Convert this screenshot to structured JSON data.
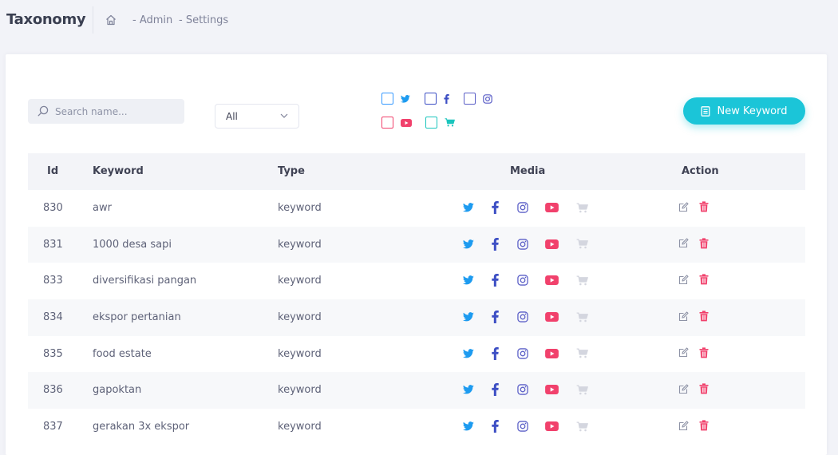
{
  "header": {
    "title": "Taxonomy",
    "breadcrumb": [
      "- Admin",
      "- Settings"
    ]
  },
  "toolbar": {
    "search_placeholder": "Search name...",
    "select_value": "All",
    "new_button_label": "New Keyword",
    "filters": [
      {
        "media": "twitter",
        "icon": "twitter-icon",
        "color": "#1da1f2",
        "checked": false
      },
      {
        "media": "facebook",
        "icon": "facebook-icon",
        "color": "#3b4cc0",
        "checked": false
      },
      {
        "media": "instagram",
        "icon": "instagram-icon",
        "color": "#5b5fc7",
        "checked": false
      },
      {
        "media": "youtube",
        "icon": "youtube-icon",
        "color": "#f1416c",
        "checked": false
      },
      {
        "media": "marketplace",
        "icon": "cart-icon",
        "color": "#1bc5bd",
        "checked": false
      }
    ]
  },
  "table": {
    "columns": [
      "Id",
      "Keyword",
      "Type",
      "Media",
      "Action"
    ],
    "rows": [
      {
        "id": "830",
        "keyword": "awr",
        "type": "keyword"
      },
      {
        "id": "831",
        "keyword": "1000 desa sapi",
        "type": "keyword"
      },
      {
        "id": "833",
        "keyword": "diversifikasi pangan",
        "type": "keyword"
      },
      {
        "id": "834",
        "keyword": "ekspor pertanian",
        "type": "keyword"
      },
      {
        "id": "835",
        "keyword": "food estate",
        "type": "keyword"
      },
      {
        "id": "836",
        "keyword": "gapoktan",
        "type": "keyword"
      },
      {
        "id": "837",
        "keyword": "gerakan 3x ekspor",
        "type": "keyword"
      }
    ]
  },
  "colors": {
    "accent": "#1bc5d8",
    "twitter": "#1d9bf0",
    "facebook": "#3d4fc4",
    "instagram": "#5b5fc7",
    "youtube": "#f1416c",
    "cart_disabled": "#c9cbd6",
    "delete": "#f1416c",
    "edit": "#8e93a6"
  }
}
